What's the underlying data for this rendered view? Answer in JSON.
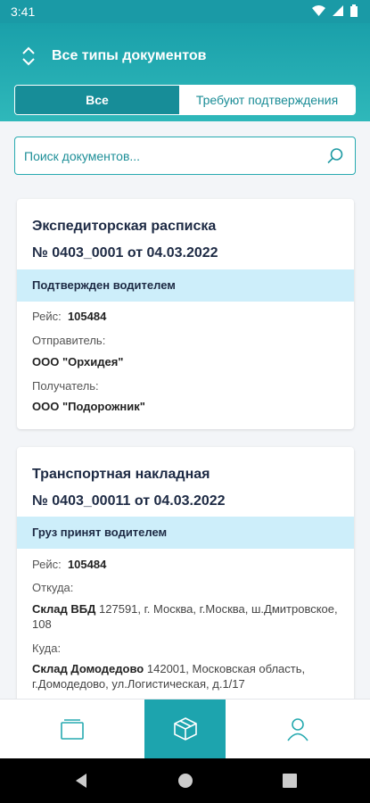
{
  "status_bar": {
    "time": "3:41"
  },
  "header": {
    "doc_type_label": "Все типы документов",
    "tabs": [
      {
        "label": "Все",
        "active": true
      },
      {
        "label": "Требуют подтверждения",
        "active": false
      }
    ]
  },
  "search": {
    "placeholder": "Поиск документов..."
  },
  "documents": [
    {
      "title": "Экспедиторская расписка",
      "number": "№ 0403_0001 от 04.03.2022",
      "status": "Подтвержден водителем",
      "trip_label": "Рейс:",
      "trip_value": "105484",
      "sender_label": "Отправитель:",
      "sender_value": "ООО \"Орхидея\"",
      "recipient_label": "Получатель:",
      "recipient_value": "ООО \"Подорожник\""
    },
    {
      "title": "Транспортная накладная",
      "number": "№ 0403_00011 от 04.03.2022",
      "status": "Груз принят водителем",
      "trip_label": "Рейс:",
      "trip_value": "105484",
      "from_label": "Откуда:",
      "from_name": "Склад ВБД",
      "from_address": "127591, г. Москва, г.Москва, ш.Дмитровское, 108",
      "to_label": "Куда:",
      "to_name": "Склад Домодедово",
      "to_address": "142001, Московская область, г.Домодедово, ул.Логистическая, д.1/17"
    }
  ],
  "bottom_nav": {
    "items": [
      "documents-icon",
      "package-icon",
      "profile-icon"
    ],
    "active_index": 1
  },
  "colors": {
    "accent": "#1da4ae",
    "status_bg": "#cdeefa",
    "text_dark": "#1d2a44"
  }
}
